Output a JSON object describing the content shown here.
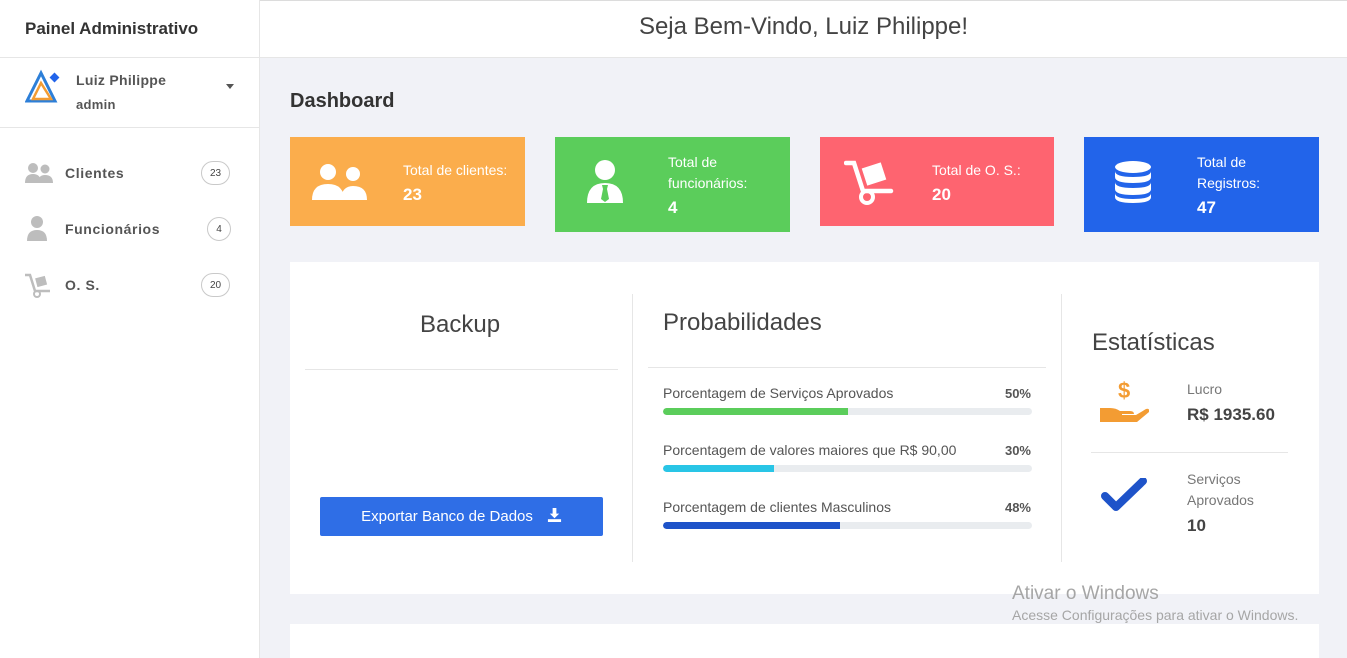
{
  "sidebar": {
    "brand": "Painel Administrativo",
    "user": {
      "name": "Luiz Philippe",
      "role": "admin"
    },
    "items": [
      {
        "label": "Clientes",
        "badge": "23",
        "icon": "users-icon"
      },
      {
        "label": "Funcionários",
        "badge": "4",
        "icon": "user-icon"
      },
      {
        "label": "O. S.",
        "badge": "20",
        "icon": "dolly-icon"
      }
    ]
  },
  "header": {
    "welcome": "Seja Bem-Vindo, Luiz Philippe!"
  },
  "page_title": "Dashboard",
  "cards": [
    {
      "label": "Total de clientes:",
      "value": "23",
      "color": "#fbad4c",
      "icon": "users-icon"
    },
    {
      "label": "Total de funcionários:",
      "value": "4",
      "color": "#5bcd5b",
      "icon": "user-tie-icon"
    },
    {
      "label": "Total de O. S.:",
      "value": "20",
      "color": "#fe6470",
      "icon": "dolly-icon"
    },
    {
      "label": "Total de Registros:",
      "value": "47",
      "color": "#2264ea",
      "icon": "database-icon"
    }
  ],
  "backup": {
    "title": "Backup",
    "button": "Exportar Banco de Dados"
  },
  "probabilities": {
    "title": "Probabilidades",
    "items": [
      {
        "label": "Porcentagem de Serviços Aprovados",
        "pct_text": "50%",
        "value": 0.5,
        "color": "#5bcd5b"
      },
      {
        "label": "Porcentagem de valores maiores que R$ 90,00",
        "pct_text": "30%",
        "value": 0.3,
        "color": "#29c5e6"
      },
      {
        "label": "Porcentagem de clientes Masculinos",
        "pct_text": "48%",
        "value": 0.48,
        "color": "#1e53c9"
      }
    ]
  },
  "stats": {
    "title": "Estatísticas",
    "profit": {
      "label": "Lucro",
      "value": "R$ 1935.60",
      "icon": "hand-dollar-icon"
    },
    "approved": {
      "label": "Serviços Aprovados",
      "value": "10",
      "icon": "check-icon"
    }
  },
  "watermark": {
    "line1": "Ativar o Windows",
    "line2": "Acesse Configurações para ativar o Windows."
  }
}
